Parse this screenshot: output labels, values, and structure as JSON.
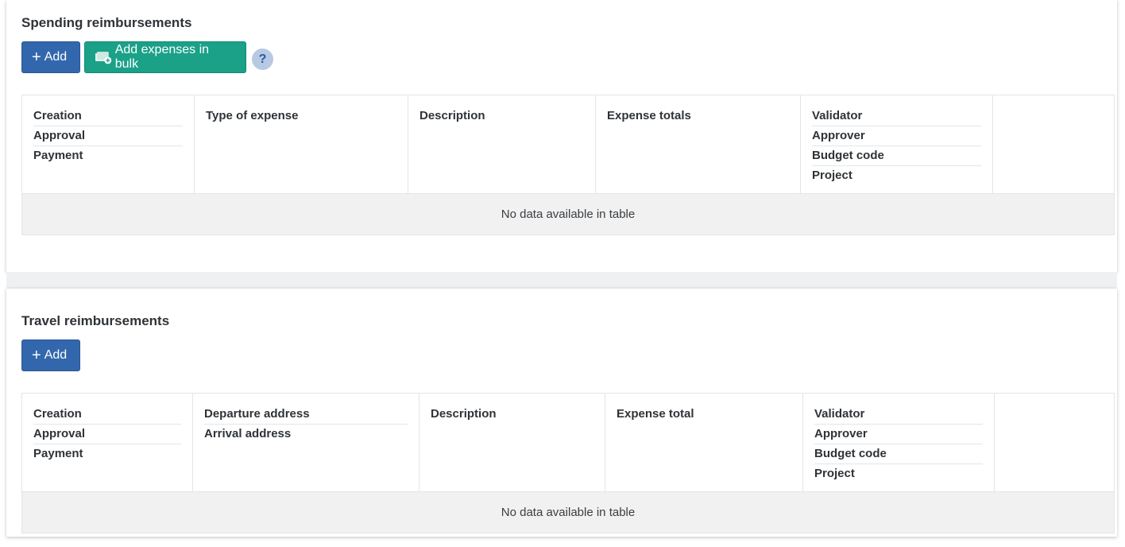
{
  "spending": {
    "title": "Spending reimbursements",
    "add_label": "Add",
    "bulk_label": "Add expenses in bulk",
    "help_label": "?",
    "columns": [
      [
        "Creation",
        "Approval",
        "Payment"
      ],
      [
        "Type of expense"
      ],
      [
        "Description"
      ],
      [
        "Expense totals"
      ],
      [
        "Validator",
        "Approver",
        "Budget code",
        "Project"
      ],
      []
    ],
    "empty_text": "No data available in table"
  },
  "travel": {
    "title": "Travel reimbursements",
    "add_label": "Add",
    "columns": [
      [
        "Creation",
        "Approval",
        "Payment"
      ],
      [
        "Departure address",
        "Arrival address"
      ],
      [
        "Description"
      ],
      [
        "Expense total"
      ],
      [
        "Validator",
        "Approver",
        "Budget code",
        "Project"
      ],
      []
    ],
    "empty_text": "No data available in table"
  },
  "colors": {
    "primary": "#3367ad",
    "success": "#1aa188",
    "help_bg": "#b8c9e3"
  }
}
